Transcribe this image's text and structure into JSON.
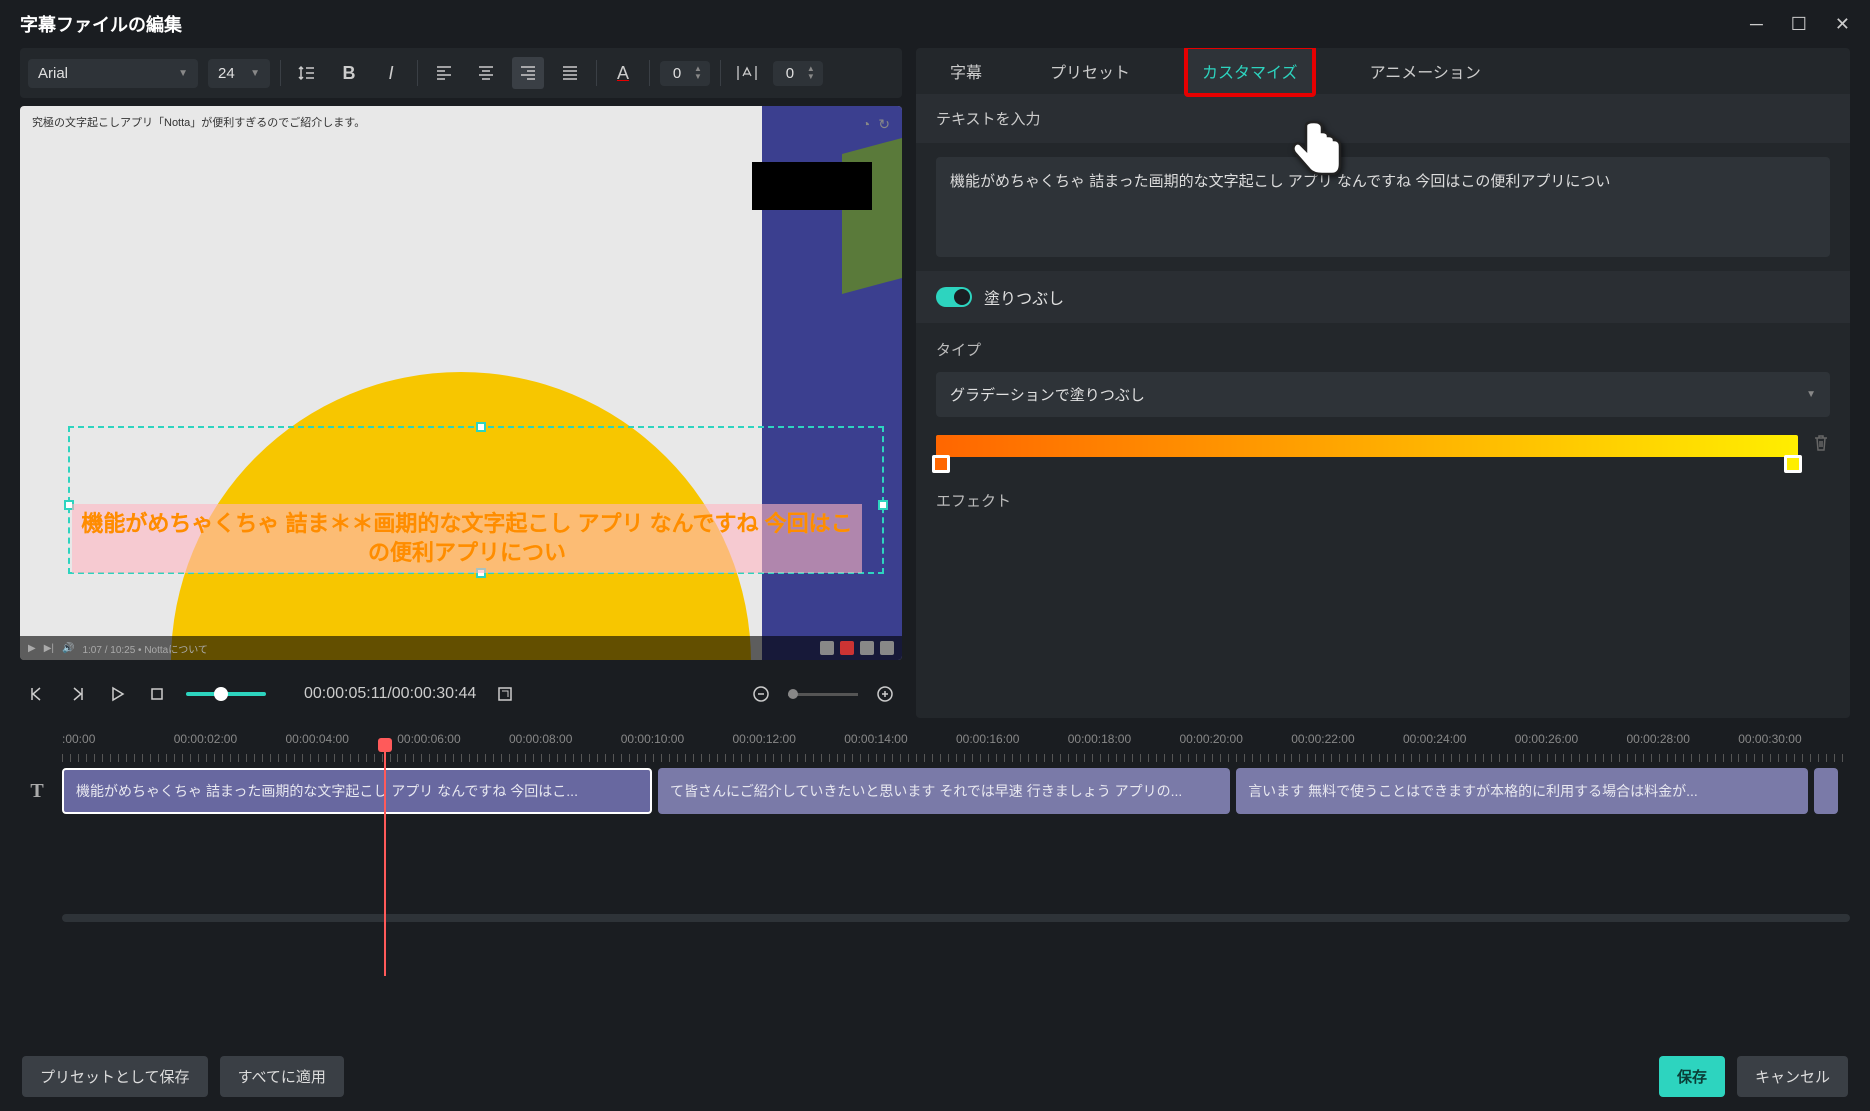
{
  "titlebar": {
    "title": "字幕ファイルの編集"
  },
  "toolbar": {
    "font": "Arial",
    "size": "24",
    "rotation": "0",
    "spacing": "0"
  },
  "preview": {
    "top_caption": "究極の文字起こしアプリ「Notta」が便利すぎるのでご紹介します。",
    "subtitle_line": "機能がめちゃくちゃ 詰ま＊＊画期的な文字起こし アプリ なんですね 今回はこの便利アプリについ",
    "bottom_status": "1:07 / 10:25 • Nottaについて"
  },
  "transport": {
    "time": "00:00:05:11/00:00:30:44"
  },
  "tabs": {
    "subtitle": "字幕",
    "preset": "プリセット",
    "customize": "カスタマイズ",
    "animation": "アニメーション"
  },
  "right": {
    "input_label": "テキストを入力",
    "text_value": "機能がめちゃくちゃ 詰まった画期的な文字起こし アプリ なんですね 今回はこの便利アプリについ",
    "fill_label": "塗りつぶし",
    "type_label": "タイプ",
    "type_value": "グラデーションで塗りつぶし",
    "effect_label": "エフェクト"
  },
  "timeline": {
    "ticks": [
      ":00:00",
      "00:00:02:00",
      "00:00:04:00",
      "00:00:06:00",
      "00:00:08:00",
      "00:00:10:00",
      "00:00:12:00",
      "00:00:14:00",
      "00:00:16:00",
      "00:00:18:00",
      "00:00:20:00",
      "00:00:22:00",
      "00:00:24:00",
      "00:00:26:00",
      "00:00:28:00",
      "00:00:30:00"
    ],
    "clips": [
      "機能がめちゃくちゃ 詰まった画期的な文字起こし アプリ なんですね 今回はこ...",
      "て皆さんにご紹介していきたいと思います それでは早速 行きましょう アプリの...",
      "言います 無料で使うことはできますが本格的に利用する場合は料金が..."
    ]
  },
  "footer": {
    "save_preset": "プリセットとして保存",
    "apply_all": "すべてに適用",
    "save": "保存",
    "cancel": "キャンセル"
  }
}
